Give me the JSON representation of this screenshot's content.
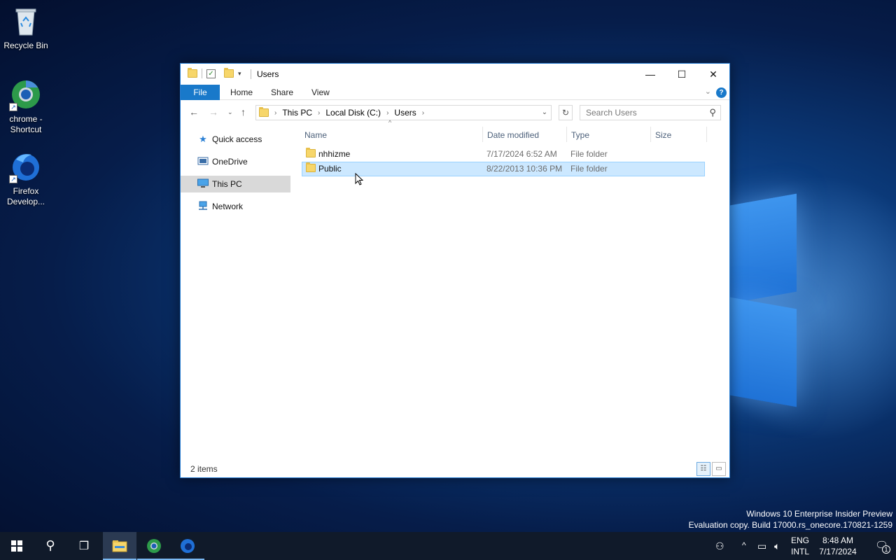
{
  "desktop": {
    "icons": [
      {
        "label": "Recycle Bin"
      },
      {
        "label": "chrome - Shortcut"
      },
      {
        "label": "Firefox Develop..."
      }
    ]
  },
  "window": {
    "title": "Users",
    "controls": {
      "minimize": "—",
      "maximize": "☐",
      "close": "✕"
    },
    "ribbon_tabs": [
      "File",
      "Home",
      "Share",
      "View"
    ],
    "help": "?",
    "address": {
      "crumbs": [
        "This PC",
        "Local Disk (C:)",
        "Users"
      ]
    },
    "search": {
      "placeholder": "Search Users"
    },
    "sidebar": [
      {
        "label": "Quick access",
        "icon": "star-icon"
      },
      {
        "label": "OneDrive",
        "icon": "onedrive-icon"
      },
      {
        "label": "This PC",
        "icon": "computer-icon",
        "selected": true
      },
      {
        "label": "Network",
        "icon": "network-icon"
      }
    ],
    "columns": [
      "Name",
      "Date modified",
      "Type",
      "Size"
    ],
    "files": [
      {
        "name": "nhhizme",
        "date": "7/17/2024 6:52 AM",
        "type": "File folder",
        "size": "",
        "selected": false
      },
      {
        "name": "Public",
        "date": "8/22/2013 10:36 PM",
        "type": "File folder",
        "size": "",
        "selected": true
      }
    ],
    "status": {
      "items": "2 items"
    }
  },
  "watermark": {
    "line1": "Windows 10 Enterprise Insider Preview",
    "line2": "Evaluation copy. Build 17000.rs_onecore.170821-1259"
  },
  "taskbar": {
    "lang": {
      "top": "ENG",
      "bottom": "INTL"
    },
    "clock": {
      "time": "8:48 AM",
      "date": "7/17/2024"
    },
    "notifications_count": "1"
  },
  "colors": {
    "accent": "#1979ca",
    "selection": "#cce8ff",
    "taskbar": "#101a2a"
  }
}
